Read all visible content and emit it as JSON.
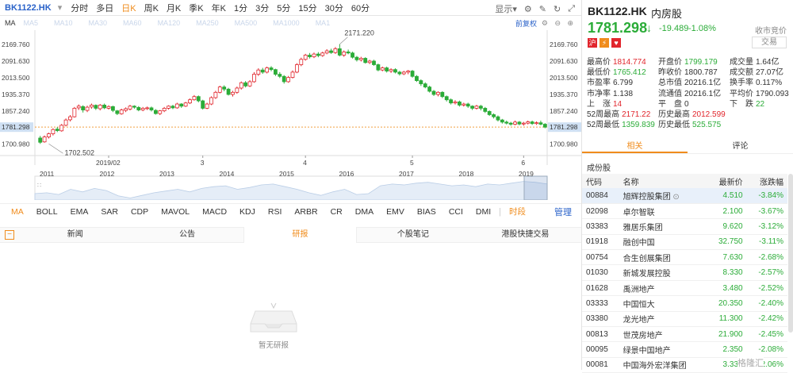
{
  "header": {
    "symbol": "BK1122.HK",
    "periods": [
      "分时",
      "多日",
      "日K",
      "周K",
      "月K",
      "季K",
      "年K",
      "1分",
      "3分",
      "5分",
      "15分",
      "30分",
      "60分"
    ],
    "active_period": "日K",
    "display": "显示",
    "display_arrow": "▾"
  },
  "ma_bar": {
    "ma": "MA",
    "items": [
      "MA5",
      "MA10",
      "MA30",
      "MA60",
      "MA120",
      "MA250",
      "MA500",
      "MA1000",
      "MA1"
    ],
    "adjust": "前复权"
  },
  "chart_data": {
    "type": "candlestick",
    "y_ticks": [
      "2169.760",
      "2091.630",
      "2013.500",
      "1935.370",
      "1857.240",
      "1781.298",
      "1700.980"
    ],
    "y_values": [
      2169.76,
      2091.63,
      2013.5,
      1935.37,
      1857.24,
      1781.298,
      1700.98
    ],
    "current_price": "1781.298",
    "current_value": 1781.298,
    "ylim": [
      1670,
      2215
    ],
    "x_labels": [
      {
        "label": "2019/02",
        "index": 16
      },
      {
        "label": "3",
        "index": 38
      },
      {
        "label": "4",
        "index": 62
      },
      {
        "label": "5",
        "index": 87
      },
      {
        "label": "6",
        "index": 113
      }
    ],
    "annotations": [
      {
        "text": "2171.220",
        "index": 70,
        "value": 2171.22
      },
      {
        "text": "1702.502",
        "index": 2,
        "value": 1702.502
      }
    ],
    "candles": [
      [
        1730,
        1710,
        1740,
        1702.5
      ],
      [
        1712,
        1735,
        1742,
        1708
      ],
      [
        1735,
        1750,
        1755,
        1728
      ],
      [
        1750,
        1770,
        1776,
        1742
      ],
      [
        1772,
        1765,
        1782,
        1758
      ],
      [
        1764,
        1790,
        1796,
        1760
      ],
      [
        1790,
        1815,
        1822,
        1785
      ],
      [
        1816,
        1830,
        1838,
        1808
      ],
      [
        1830,
        1870,
        1876,
        1826
      ],
      [
        1872,
        1880,
        1888,
        1862
      ],
      [
        1878,
        1862,
        1884,
        1850
      ],
      [
        1860,
        1875,
        1882,
        1852
      ],
      [
        1876,
        1885,
        1892,
        1868
      ],
      [
        1884,
        1870,
        1888,
        1862
      ],
      [
        1868,
        1885,
        1890,
        1860
      ],
      [
        1885,
        1872,
        1892,
        1866
      ],
      [
        1870,
        1878,
        1884,
        1864
      ],
      [
        1878,
        1860,
        1882,
        1852
      ],
      [
        1858,
        1845,
        1862,
        1838
      ],
      [
        1844,
        1862,
        1868,
        1840
      ],
      [
        1860,
        1868,
        1874,
        1852
      ],
      [
        1866,
        1880,
        1886,
        1860
      ],
      [
        1880,
        1875,
        1884,
        1868
      ],
      [
        1874,
        1862,
        1880,
        1856
      ],
      [
        1862,
        1870,
        1876,
        1856
      ],
      [
        1870,
        1872,
        1878,
        1862
      ],
      [
        1872,
        1862,
        1878,
        1855
      ],
      [
        1860,
        1845,
        1866,
        1840
      ],
      [
        1845,
        1858,
        1862,
        1838
      ],
      [
        1858,
        1870,
        1876,
        1852
      ],
      [
        1870,
        1880,
        1884,
        1864
      ],
      [
        1880,
        1872,
        1886,
        1866
      ],
      [
        1872,
        1890,
        1896,
        1868
      ],
      [
        1890,
        1880,
        1894,
        1872
      ],
      [
        1880,
        1895,
        1900,
        1876
      ],
      [
        1895,
        1910,
        1916,
        1890
      ],
      [
        1910,
        1925,
        1932,
        1906
      ],
      [
        1925,
        1905,
        1930,
        1898
      ],
      [
        1905,
        1870,
        1910,
        1864
      ],
      [
        1870,
        1890,
        1896,
        1866
      ],
      [
        1890,
        1920,
        1926,
        1885
      ],
      [
        1920,
        1945,
        1952,
        1914
      ],
      [
        1945,
        1970,
        1976,
        1940
      ],
      [
        1970,
        1960,
        1978,
        1950
      ],
      [
        1960,
        1935,
        1966,
        1930
      ],
      [
        1935,
        1945,
        1952,
        1925
      ],
      [
        1945,
        1965,
        1972,
        1938
      ],
      [
        1965,
        1990,
        1996,
        1958
      ],
      [
        1990,
        1975,
        1998,
        1968
      ],
      [
        1975,
        1995,
        2002,
        1970
      ],
      [
        1995,
        2030,
        2040,
        1990
      ],
      [
        2030,
        2050,
        2058,
        2022
      ],
      [
        2050,
        2040,
        2060,
        2032
      ],
      [
        2040,
        2060,
        2066,
        2034
      ],
      [
        2060,
        2052,
        2068,
        2044
      ],
      [
        2052,
        2030,
        2056,
        2022
      ],
      [
        2030,
        2020,
        2040,
        2012
      ],
      [
        2020,
        1995,
        2026,
        1986
      ],
      [
        1995,
        2015,
        2022,
        1990
      ],
      [
        2015,
        2040,
        2048,
        2010
      ],
      [
        2040,
        2075,
        2082,
        2035
      ],
      [
        2075,
        2100,
        2108,
        2068
      ],
      [
        2100,
        2120,
        2126,
        2094
      ],
      [
        2120,
        2112,
        2130,
        2104
      ],
      [
        2112,
        2125,
        2132,
        2106
      ],
      [
        2125,
        2118,
        2134,
        2110
      ],
      [
        2118,
        2130,
        2136,
        2112
      ],
      [
        2130,
        2140,
        2148,
        2124
      ],
      [
        2140,
        2132,
        2150,
        2126
      ],
      [
        2132,
        2150,
        2158,
        2126
      ],
      [
        2150,
        2120,
        2171.22,
        2114
      ],
      [
        2120,
        2135,
        2142,
        2112
      ],
      [
        2135,
        2130,
        2146,
        2124
      ],
      [
        2130,
        2110,
        2136,
        2104
      ],
      [
        2110,
        2098,
        2116,
        2090
      ],
      [
        2098,
        2105,
        2112,
        2090
      ],
      [
        2105,
        2085,
        2110,
        2080
      ],
      [
        2085,
        2092,
        2098,
        2078
      ],
      [
        2092,
        2075,
        2098,
        2070
      ],
      [
        2075,
        2050,
        2080,
        2044
      ],
      [
        2050,
        2060,
        2066,
        2044
      ],
      [
        2060,
        2045,
        2066,
        2038
      ],
      [
        2045,
        2052,
        2058,
        2036
      ],
      [
        2052,
        2040,
        2058,
        2034
      ],
      [
        2040,
        2032,
        2046,
        2024
      ],
      [
        2032,
        2040,
        2046,
        2026
      ],
      [
        2040,
        2045,
        2050,
        2030
      ],
      [
        2045,
        2020,
        2050,
        2014
      ],
      [
        2020,
        2000,
        2026,
        1994
      ],
      [
        2000,
        1985,
        2006,
        1975
      ],
      [
        1985,
        1970,
        1992,
        1964
      ],
      [
        1970,
        1950,
        1976,
        1944
      ],
      [
        1950,
        1935,
        1956,
        1928
      ],
      [
        1935,
        1945,
        1950,
        1926
      ],
      [
        1945,
        1925,
        1950,
        1918
      ],
      [
        1925,
        1910,
        1930,
        1902
      ],
      [
        1910,
        1895,
        1916,
        1888
      ],
      [
        1895,
        1900,
        1908,
        1888
      ],
      [
        1900,
        1885,
        1906,
        1878
      ],
      [
        1885,
        1890,
        1896,
        1878
      ],
      [
        1890,
        1880,
        1896,
        1872
      ],
      [
        1880,
        1870,
        1884,
        1862
      ],
      [
        1870,
        1880,
        1886,
        1864
      ],
      [
        1880,
        1870,
        1886,
        1860
      ],
      [
        1870,
        1855,
        1876,
        1848
      ],
      [
        1855,
        1840,
        1860,
        1834
      ],
      [
        1840,
        1830,
        1846,
        1822
      ],
      [
        1830,
        1815,
        1836,
        1808
      ],
      [
        1815,
        1805,
        1820,
        1798
      ],
      [
        1805,
        1800,
        1812,
        1794
      ],
      [
        1800,
        1795,
        1806,
        1788
      ],
      [
        1795,
        1805,
        1812,
        1790
      ],
      [
        1805,
        1796,
        1810,
        1790
      ],
      [
        1796,
        1800,
        1806,
        1788
      ],
      [
        1800,
        1806,
        1812,
        1794
      ],
      [
        1806,
        1798,
        1812,
        1792
      ],
      [
        1798,
        1802,
        1808,
        1792
      ],
      [
        1802,
        1795,
        1812,
        1790
      ],
      [
        1795,
        1781.298,
        1800,
        1776
      ]
    ]
  },
  "navigator": {
    "years": [
      "2011",
      "2012",
      "2013",
      "2014",
      "2015",
      "2016",
      "2017",
      "2018",
      "2019"
    ],
    "series": [
      40,
      38,
      42,
      30,
      36,
      28,
      33,
      45,
      50,
      44,
      38,
      34,
      30,
      36,
      28,
      24,
      22,
      30,
      26,
      20,
      18,
      24,
      30,
      38,
      44,
      36,
      30,
      42,
      40,
      22,
      18,
      20,
      16,
      14,
      18,
      22,
      20,
      24,
      18,
      20,
      16,
      12,
      14,
      18
    ]
  },
  "indicators": {
    "items": [
      "MA",
      "BOLL",
      "EMA",
      "SAR",
      "CDP",
      "MAVOL",
      "MACD",
      "KDJ",
      "RSI",
      "ARBR",
      "CR",
      "DMA",
      "EMV",
      "BIAS",
      "CCI",
      "DMI"
    ],
    "active": "MA",
    "shift": "时段",
    "manage": "管理"
  },
  "news": {
    "tabs": [
      "新闻",
      "公告",
      "研报",
      "个股笔记",
      "港股快捷交易"
    ],
    "active": "研报",
    "empty": "暂无研报"
  },
  "quote": {
    "symbol": "BK1122.HK",
    "name": "内房股",
    "price": "1781.298",
    "arrow": "↓",
    "change": "-19.489",
    "pct": "-1.08%",
    "close_label": "收市竞价",
    "trade": "交易",
    "icons": [
      "沪",
      "⚡",
      "♥"
    ],
    "stats": [
      [
        {
          "l": "最高价",
          "v": "1814.774",
          "c": "red"
        },
        {
          "l": "开盘价",
          "v": "1799.179",
          "c": "grn"
        },
        {
          "l": "成交量",
          "v": "1.64亿",
          "c": "blk"
        }
      ],
      [
        {
          "l": "最低价",
          "v": "1765.412",
          "c": "grn"
        },
        {
          "l": "昨收价",
          "v": "1800.787",
          "c": "blk"
        },
        {
          "l": "成交额",
          "v": "27.07亿",
          "c": "blk"
        }
      ],
      [
        {
          "l": "市盈率",
          "v": "6.799",
          "c": "blk"
        },
        {
          "l": "总市值",
          "v": "20216.1亿",
          "c": "blk"
        },
        {
          "l": "换手率",
          "v": "0.117%",
          "c": "blk"
        }
      ],
      [
        {
          "l": "市净率",
          "v": "1.138",
          "c": "blk"
        },
        {
          "l": "流通值",
          "v": "20216.1亿",
          "c": "blk"
        },
        {
          "l": "平均价",
          "v": "1790.093",
          "c": "blk"
        }
      ],
      [
        {
          "l": "上　涨",
          "v": "14",
          "c": "red"
        },
        {
          "l": "平　盘",
          "v": "0",
          "c": "blk"
        },
        {
          "l": "下　跌",
          "v": "22",
          "c": "grn"
        }
      ],
      [
        {
          "l": "52周最高",
          "v": "2171.22",
          "c": "red"
        },
        {
          "l": "历史最高",
          "v": "2012.599",
          "c": "red"
        },
        {
          "l": "",
          "v": "",
          "c": "blk"
        }
      ],
      [
        {
          "l": "52周最低",
          "v": "1359.839",
          "c": "grn"
        },
        {
          "l": "历史最低",
          "v": "525.575",
          "c": "grn"
        },
        {
          "l": "",
          "v": "",
          "c": "blk"
        }
      ]
    ],
    "tabs": [
      "相关",
      "评论"
    ],
    "active_tab": "相关",
    "components_title": "成份股",
    "table_headers": [
      "代码",
      "名称",
      "最新价",
      "涨跌幅"
    ],
    "rows": [
      [
        "00884",
        "旭辉控股集团",
        "4.510",
        "-3.84%"
      ],
      [
        "02098",
        "卓尔智联",
        "2.100",
        "-3.67%"
      ],
      [
        "03383",
        "雅居乐集团",
        "9.620",
        "-3.12%"
      ],
      [
        "01918",
        "融创中国",
        "32.750",
        "-3.11%"
      ],
      [
        "00754",
        "合生创展集团",
        "7.630",
        "-2.68%"
      ],
      [
        "01030",
        "新城发展控股",
        "8.330",
        "-2.57%"
      ],
      [
        "01628",
        "禹洲地产",
        "3.480",
        "-2.52%"
      ],
      [
        "03333",
        "中国恒大",
        "20.350",
        "-2.40%"
      ],
      [
        "03380",
        "龙光地产",
        "11.300",
        "-2.42%"
      ],
      [
        "00813",
        "世茂房地产",
        "21.900",
        "-2.45%"
      ],
      [
        "00095",
        "绿景中国地产",
        "2.350",
        "-2.08%"
      ],
      [
        "00081",
        "中国海外宏洋集团",
        "3.330",
        "-2.06%"
      ]
    ],
    "watermark": "格隆汇"
  },
  "colors": {
    "up": "#e1262d",
    "down": "#2bac38",
    "accent": "#f08c1c",
    "link": "#2a62c9"
  }
}
